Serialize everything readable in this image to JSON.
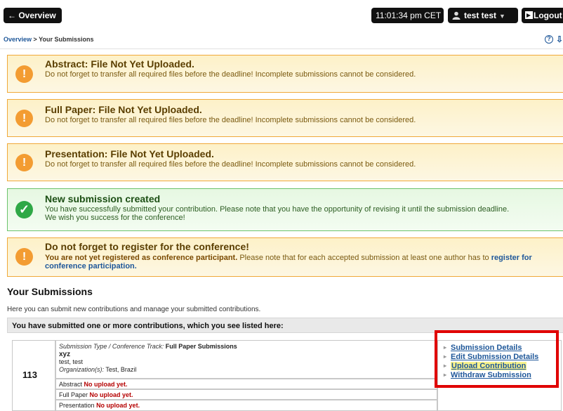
{
  "topbar": {
    "overview_label": "← Overview",
    "clock": "11:01:34 pm CET",
    "user_label": "test test",
    "logout_label": "Logout"
  },
  "breadcrumb": {
    "home": "Overview",
    "separator": " > ",
    "current": "Your Submissions",
    "help": "?",
    "download": "⇩"
  },
  "alerts": [
    {
      "type": "warning",
      "icon": "exclamation-icon",
      "title": "Abstract: File Not Yet Uploaded.",
      "text": "Do not forget to transfer all required files before the deadline! Incomplete submissions cannot be considered."
    },
    {
      "type": "warning",
      "icon": "exclamation-icon",
      "title": "Full Paper: File Not Yet Uploaded.",
      "text": "Do not forget to transfer all required files before the deadline! Incomplete submissions cannot be considered."
    },
    {
      "type": "warning",
      "icon": "exclamation-icon",
      "title": "Presentation: File Not Yet Uploaded.",
      "text": "Do not forget to transfer all required files before the deadline! Incomplete submissions cannot be considered."
    },
    {
      "type": "success",
      "icon": "checkmark-icon",
      "title": "New submission created",
      "text": "You have successfully submitted your contribution. Please note that you have the opportunity of revising it until the submission deadline. We wish you success for the conference!"
    },
    {
      "type": "warning",
      "icon": "exclamation-icon",
      "title": "Do not forget to register for the conference!",
      "text_bold": "You are not yet registered as conference participant.",
      "text": " Please note that for each accepted submission at least one author has to ",
      "link": "register for conference participation."
    }
  ],
  "section": {
    "title": "Your Submissions",
    "description": "Here you can submit new contributions and manage your submitted contributions.",
    "list_header": "You have submitted one or more contributions, which you see listed here:"
  },
  "submission": {
    "id": "113",
    "type_label": "Submission Type / Conference Track:",
    "type_value": "Full Paper Submissions",
    "title": "xyz",
    "authors": "test, test",
    "org_label": "Organization(s):",
    "org_value": "Test, Brazil",
    "uploads": [
      {
        "label": "Abstract",
        "status": "No upload yet."
      },
      {
        "label": "Full Paper",
        "status": "No upload yet."
      },
      {
        "label": "Presentation",
        "status": "No upload yet."
      }
    ],
    "actions": [
      "Submission Details",
      "Edit Submission Details",
      "Upload Contribution",
      "Withdraw Submission"
    ]
  }
}
